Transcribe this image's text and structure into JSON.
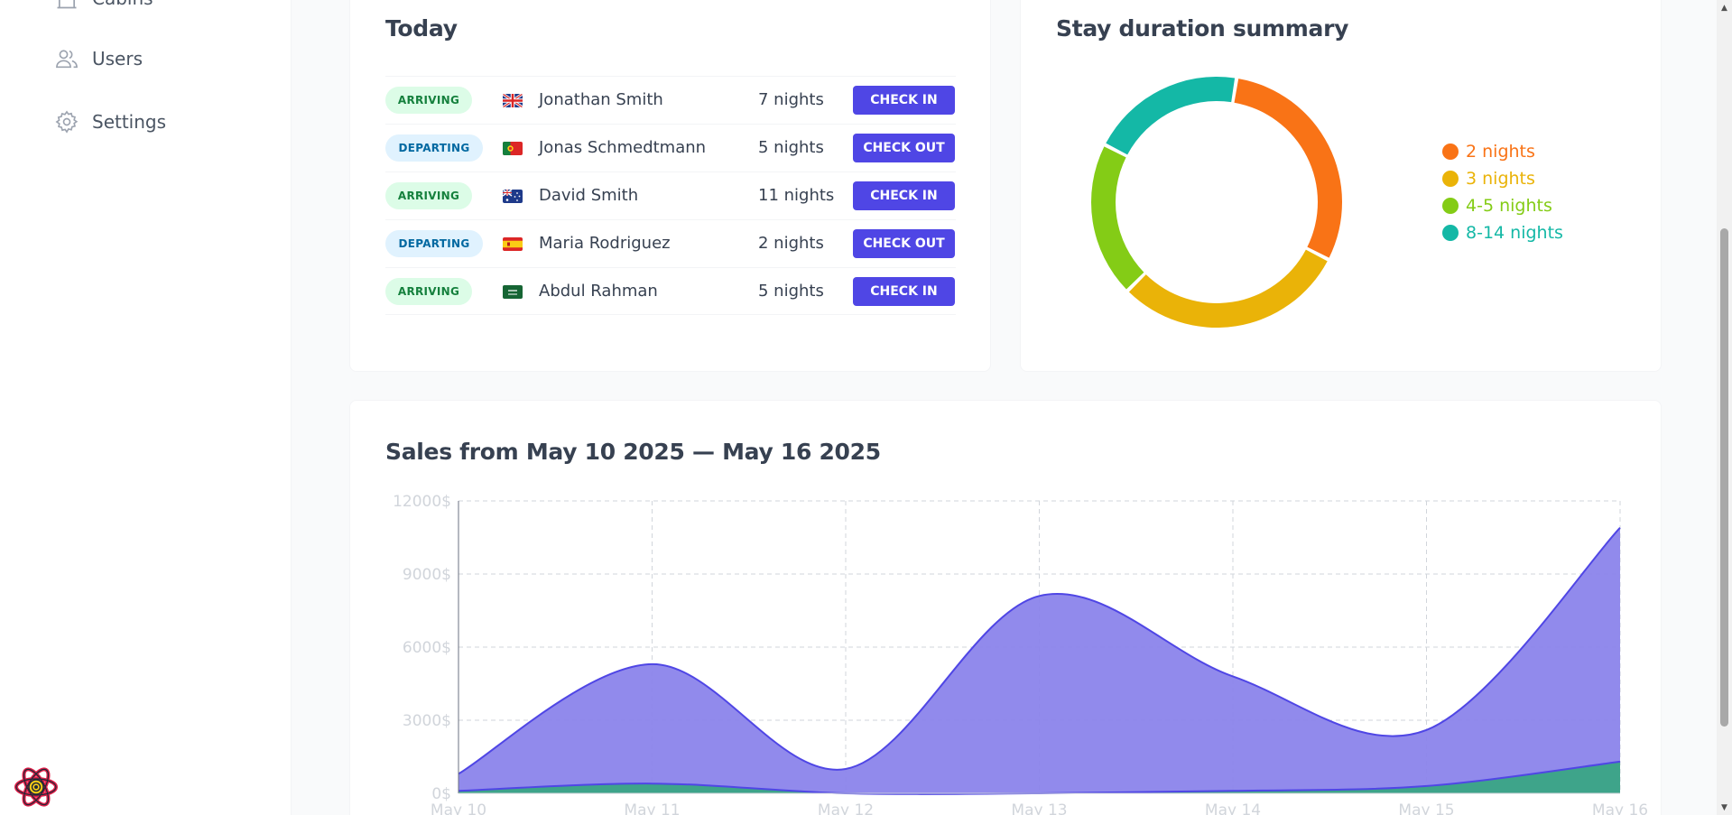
{
  "sidebar": {
    "items": [
      {
        "label": "Cabins",
        "icon": "cabins-icon"
      },
      {
        "label": "Users",
        "icon": "users-icon"
      },
      {
        "label": "Settings",
        "icon": "gear-icon"
      }
    ]
  },
  "today": {
    "title": "Today",
    "rows": [
      {
        "status": "ARRIVING",
        "flag": "uk-flag",
        "name": "Jonathan Smith",
        "nights": "7 nights",
        "action": "CHECK IN"
      },
      {
        "status": "DEPARTING",
        "flag": "portugal-flag",
        "name": "Jonas Schmedtmann",
        "nights": "5 nights",
        "action": "CHECK OUT"
      },
      {
        "status": "ARRIVING",
        "flag": "australia-flag",
        "name": "David Smith",
        "nights": "11 nights",
        "action": "CHECK IN"
      },
      {
        "status": "DEPARTING",
        "flag": "spain-flag",
        "name": "Maria Rodriguez",
        "nights": "2 nights",
        "action": "CHECK OUT"
      },
      {
        "status": "ARRIVING",
        "flag": "saudi-arabia-flag",
        "name": "Abdul Rahman",
        "nights": "5 nights",
        "action": "CHECK IN"
      }
    ]
  },
  "stay_summary": {
    "title": "Stay duration summary"
  },
  "sales": {
    "title": "Sales from May 10 2025 — May 16 2025"
  },
  "colors": {
    "accent": "#4f46e5",
    "arriving_bg": "#dcfce7",
    "arriving_text": "#15803d",
    "departing_bg": "#e0f2fe",
    "departing_text": "#0369a1"
  },
  "chart_data": [
    {
      "type": "pie",
      "variant": "donut",
      "title": "Stay duration summary",
      "legend_position": "right",
      "slices": [
        {
          "label": "2 nights",
          "value": 3,
          "color": "#f97316"
        },
        {
          "label": "3 nights",
          "value": 3,
          "color": "#eab308"
        },
        {
          "label": "4-5 nights",
          "value": 2,
          "color": "#84cc16"
        },
        {
          "label": "8-14 nights",
          "value": 2,
          "color": "#14b8a6"
        }
      ]
    },
    {
      "type": "area",
      "title": "Sales from May 10 2025 — May 16 2025",
      "categories": [
        "May 10",
        "May 11",
        "May 12",
        "May 13",
        "May 14",
        "May 15",
        "May 16"
      ],
      "ylim": [
        0,
        12000
      ],
      "yticks": [
        0,
        3000,
        6000,
        9000,
        12000
      ],
      "ytick_labels": [
        "0$",
        "3000$",
        "6000$",
        "9000$",
        "12000$"
      ],
      "grid": true,
      "series": [
        {
          "values": [
            800,
            5300,
            1000,
            8100,
            4800,
            2600,
            10900
          ],
          "stroke": "#4f46e5",
          "fill": "#8b84eb"
        },
        {
          "values": [
            100,
            400,
            0,
            0,
            100,
            300,
            1300
          ],
          "stroke": "#4f46e5",
          "fill": "#3ea48a"
        }
      ]
    }
  ]
}
